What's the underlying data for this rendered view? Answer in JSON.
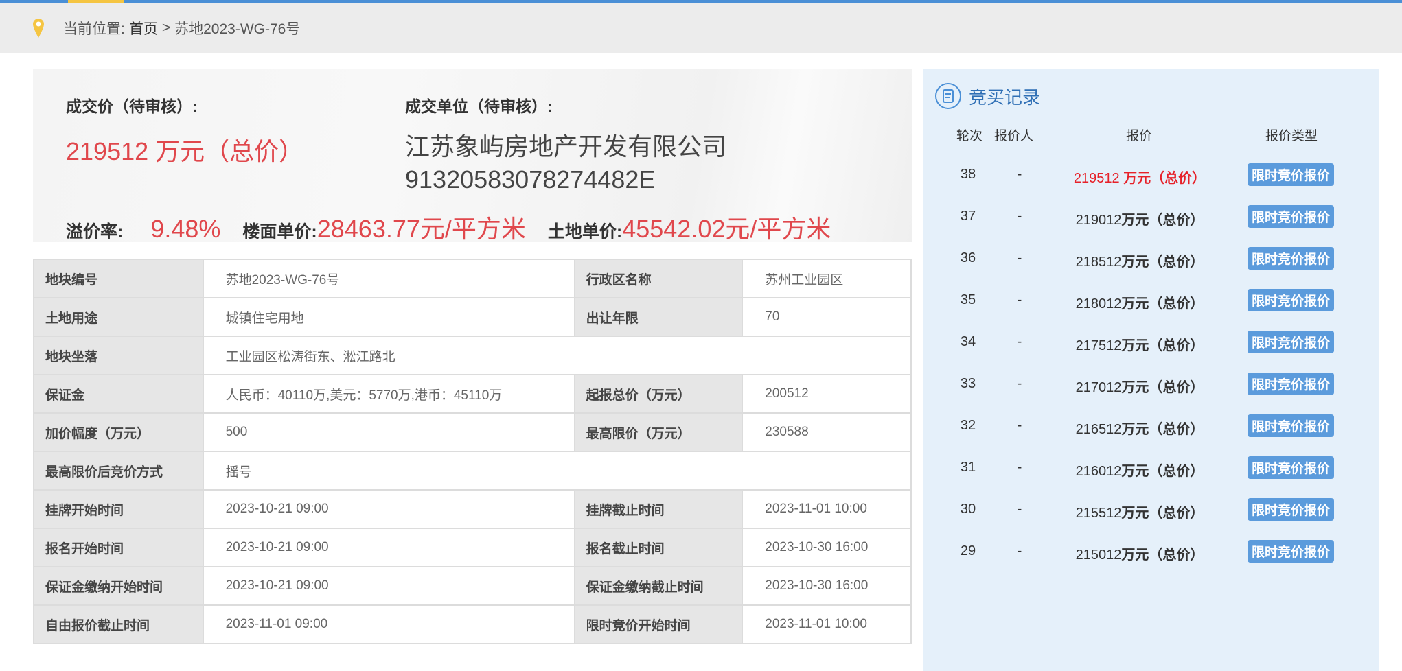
{
  "breadcrumb": {
    "prefix": "当前位置:",
    "home": "首页",
    "sep": ">",
    "current": "苏地2023-WG-76号"
  },
  "summary": {
    "price_label": "成交价（待审核）:",
    "price": "219512 万元（总价）",
    "winner_label": "成交单位（待审核）:",
    "winner_name": "江苏象屿房地产开发有限公司",
    "winner_code": "91320583078274482E",
    "premium_label": "溢价率:",
    "premium": "9.48%",
    "floor_price_label": "楼面单价:",
    "floor_price": "28463.77元/平方米",
    "land_price_label": "土地单价:",
    "land_price": "45542.02元/平方米"
  },
  "info": [
    [
      "地块编号",
      "苏地2023-WG-76号",
      "行政区名称",
      "苏州工业园区"
    ],
    [
      "土地用途",
      "城镇住宅用地",
      "出让年限",
      "70"
    ],
    [
      "地块坐落",
      "工业园区松涛街东、淞江路北"
    ],
    [
      "保证金",
      "人民币：40110万,美元：5770万,港币：45110万",
      "起报总价（万元）",
      "200512"
    ],
    [
      "加价幅度（万元）",
      "500",
      "最高限价（万元）",
      "230588"
    ],
    [
      "最高限价后竞价方式",
      "摇号"
    ],
    [
      "挂牌开始时间",
      "2023-10-21 09:00",
      "挂牌截止时间",
      "2023-11-01 10:00"
    ],
    [
      "报名开始时间",
      "2023-10-21 09:00",
      "报名截止时间",
      "2023-10-30 16:00"
    ],
    [
      "保证金缴纳开始时间",
      "2023-10-21 09:00",
      "保证金缴纳截止时间",
      "2023-10-30 16:00"
    ],
    [
      "自由报价截止时间",
      "2023-11-01 09:00",
      "限时竞价开始时间",
      "2023-11-01 10:00"
    ]
  ],
  "bids": {
    "title": "竞买记录",
    "headers": [
      "轮次",
      "报价人",
      "报价",
      "报价类型"
    ],
    "rows": [
      {
        "round": "38",
        "bidder": "-",
        "amount": "219512",
        "unit": "万元（总价）",
        "type": "限时竞价报价"
      },
      {
        "round": "37",
        "bidder": "-",
        "amount": "219012",
        "unit": "万元（总价）",
        "type": "限时竞价报价"
      },
      {
        "round": "36",
        "bidder": "-",
        "amount": "218512",
        "unit": "万元（总价）",
        "type": "限时竞价报价"
      },
      {
        "round": "35",
        "bidder": "-",
        "amount": "218012",
        "unit": "万元（总价）",
        "type": "限时竞价报价"
      },
      {
        "round": "34",
        "bidder": "-",
        "amount": "217512",
        "unit": "万元（总价）",
        "type": "限时竞价报价"
      },
      {
        "round": "33",
        "bidder": "-",
        "amount": "217012",
        "unit": "万元（总价）",
        "type": "限时竞价报价"
      },
      {
        "round": "32",
        "bidder": "-",
        "amount": "216512",
        "unit": "万元（总价）",
        "type": "限时竞价报价"
      },
      {
        "round": "31",
        "bidder": "-",
        "amount": "216012",
        "unit": "万元（总价）",
        "type": "限时竞价报价"
      },
      {
        "round": "30",
        "bidder": "-",
        "amount": "215512",
        "unit": "万元（总价）",
        "type": "限时竞价报价"
      },
      {
        "round": "29",
        "bidder": "-",
        "amount": "215012",
        "unit": "万元（总价）",
        "type": "限时竞价报价"
      }
    ]
  }
}
